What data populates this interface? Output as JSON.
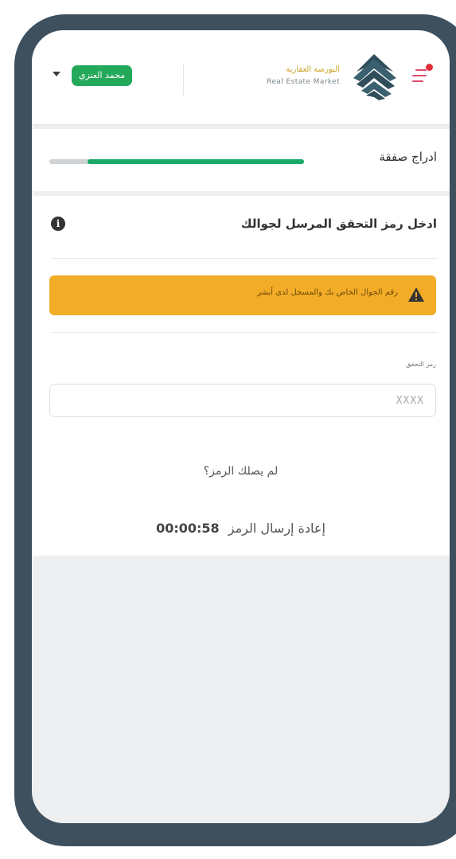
{
  "header": {
    "logo_arabic": "البورصة العقارية",
    "logo_english": "Real Estate Market",
    "user_name": "محمد العنزي",
    "icons": {
      "menu": "hamburger-menu-icon",
      "dropdown": "caret-down-icon",
      "logo": "real-estate-market-logo"
    }
  },
  "progress": {
    "step_title": "ادراج صفقة",
    "completed_fraction": 0.85
  },
  "form": {
    "heading": "ادخل رمز التحقق المرسل لجوالك",
    "alert_text": "رقم الجوال الخاص بك والمسجل لدى أبشر",
    "code_label": "رمز التحقق",
    "code_placeholder": "XXXX",
    "code_value": "",
    "resend_question": "لم يصلك الرمز؟",
    "resend_link": "إعادة إرسال الرمز",
    "countdown": "00:00:58"
  },
  "colors": {
    "frame": "#3e505e",
    "brand_green": "#1aa869",
    "badge_green": "#24a95a",
    "alert_amber": "#f3ac28",
    "menu_accent": "#e04b6b",
    "notification_dot": "#e0303a"
  }
}
